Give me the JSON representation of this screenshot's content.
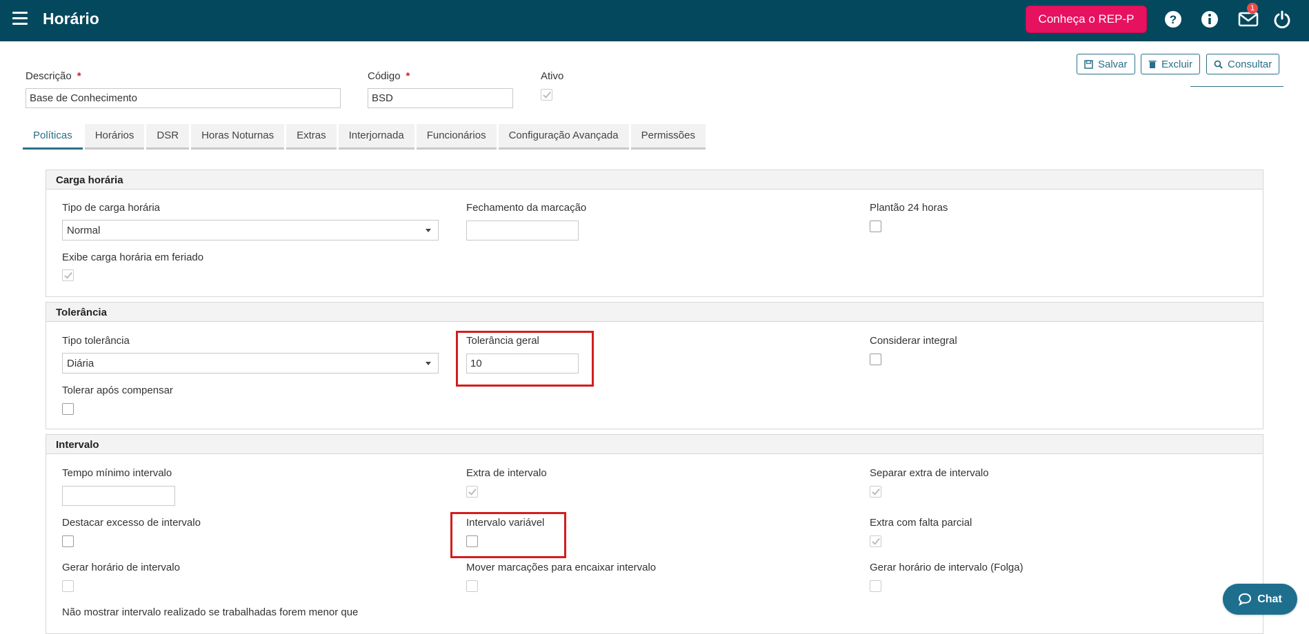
{
  "header": {
    "title": "Horário",
    "rep_button": "Conheça o REP-P",
    "notification_count": "1",
    "bg_color": "#04485e",
    "accent_color": "#e6125f"
  },
  "toolbar": {
    "save_label": "Salvar",
    "delete_label": "Excluir",
    "search_label": "Consultar"
  },
  "form": {
    "descricao_label": "Descrição",
    "descricao_value": "Base de Conhecimento",
    "codigo_label": "Código",
    "codigo_value": "BSD",
    "ativo_label": "Ativo",
    "required_mark": "*"
  },
  "tabs": [
    {
      "label": "Políticas"
    },
    {
      "label": "Horários"
    },
    {
      "label": "DSR"
    },
    {
      "label": "Horas Noturnas"
    },
    {
      "label": "Extras"
    },
    {
      "label": "Interjornada"
    },
    {
      "label": "Funcionários"
    },
    {
      "label": "Configuração Avançada"
    },
    {
      "label": "Permissões"
    }
  ],
  "carga": {
    "title": "Carga horária",
    "tipo_label": "Tipo de carga horária",
    "tipo_value": "Normal",
    "fechamento_label": "Fechamento da marcação",
    "fechamento_value": "",
    "plantao_label": "Plantão 24 horas",
    "exibe_label": "Exibe carga horária em feriado"
  },
  "tolerancia": {
    "title": "Tolerância",
    "tipo_label": "Tipo tolerância",
    "tipo_value": "Diária",
    "geral_label": "Tolerância geral",
    "geral_value": "10",
    "integral_label": "Considerar integral",
    "apos_label": "Tolerar após compensar"
  },
  "intervalo": {
    "title": "Intervalo",
    "tempo_label": "Tempo mínimo intervalo",
    "tempo_value": "",
    "extra_label": "Extra de intervalo",
    "separar_label": "Separar extra de intervalo",
    "destacar_label": "Destacar excesso de intervalo",
    "variavel_label": "Intervalo variável",
    "falta_label": "Extra com falta parcial",
    "gerar_label": "Gerar horário de intervalo",
    "mover_label": "Mover marcações para encaixar intervalo",
    "gerar_folga_label": "Gerar horário de intervalo (Folga)",
    "nao_mostrar_label": "Não mostrar intervalo realizado se trabalhadas forem menor que"
  },
  "chat": {
    "label": "Chat"
  }
}
